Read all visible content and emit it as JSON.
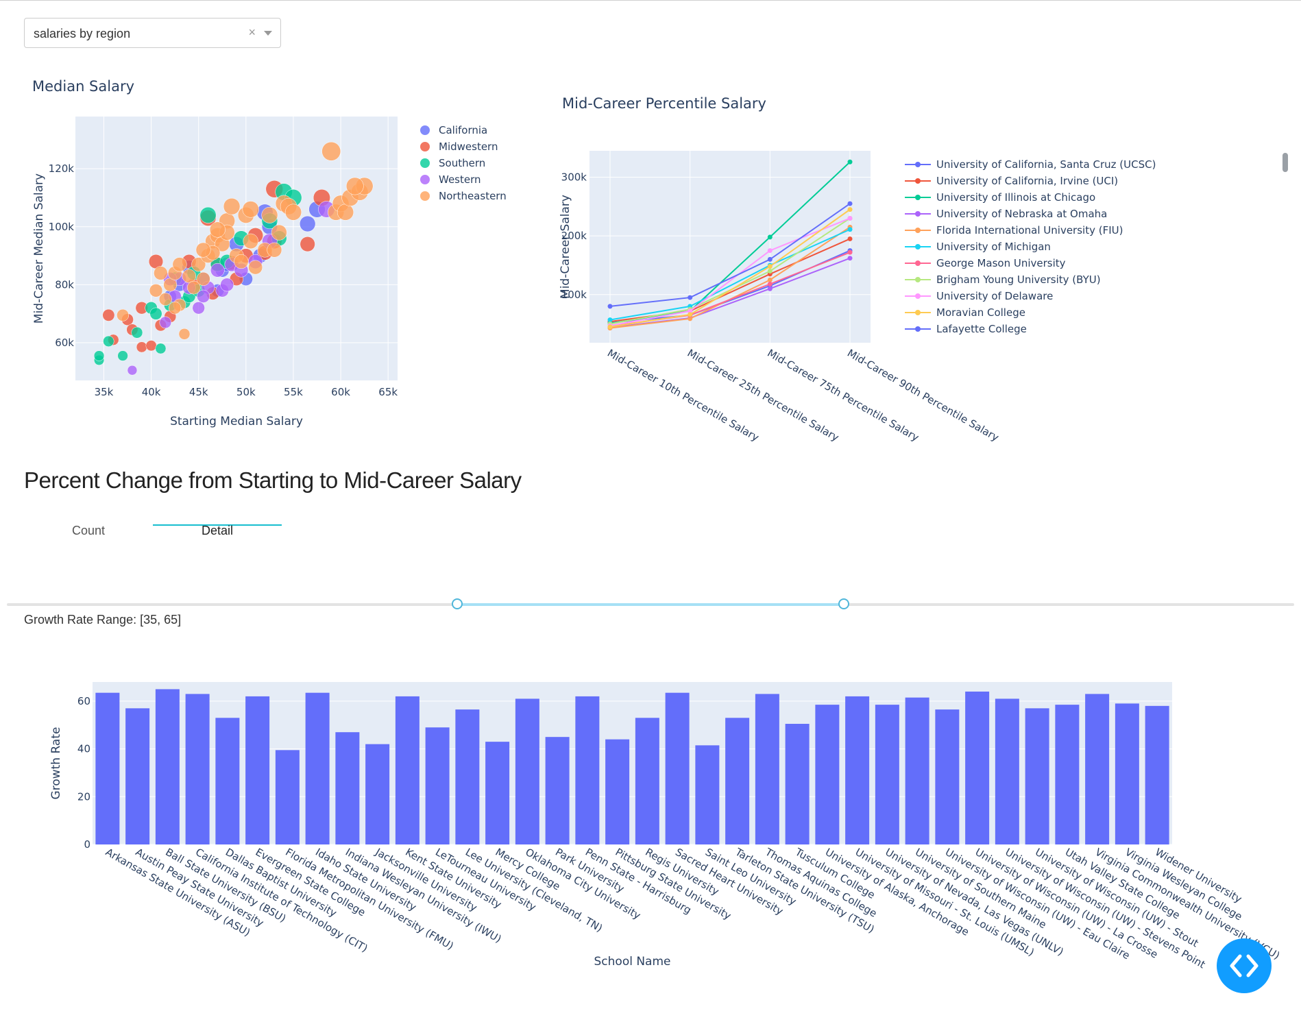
{
  "dropdown": {
    "value": "salaries by region",
    "clear_icon": "close-icon",
    "arrow_icon": "chevron-down-icon"
  },
  "section_title": "Percent Change from Starting to Mid-Career Salary",
  "tabs": [
    {
      "label": "Count",
      "active": false
    },
    {
      "label": "Detail",
      "active": true
    }
  ],
  "slider": {
    "min": 0,
    "max": 100,
    "low": 35,
    "high": 65
  },
  "range_text": "Growth Rate Range: [35, 65]",
  "fab_icon": "code-icon",
  "chart_data": [
    {
      "type": "scatter",
      "title": "Median Salary",
      "xlabel": "Starting Median Salary",
      "ylabel": "Mid-Career Median Salary",
      "xlim": [
        32000,
        66000
      ],
      "ylim": [
        47000,
        138000
      ],
      "xticks": [
        35000,
        40000,
        45000,
        50000,
        55000,
        60000,
        65000
      ],
      "xtick_labels": [
        "35k",
        "40k",
        "45k",
        "50k",
        "55k",
        "60k",
        "65k"
      ],
      "yticks": [
        60000,
        80000,
        100000,
        120000
      ],
      "ytick_labels": [
        "60k",
        "80k",
        "100k",
        "120k"
      ],
      "legend_position": "right",
      "series": [
        {
          "name": "California",
          "color": "#636efa",
          "points": [
            [
              47500,
              85000
            ],
            [
              48000,
              87000
            ],
            [
              50000,
              82000
            ],
            [
              51500,
              90000
            ],
            [
              52000,
              105000
            ],
            [
              52500,
              100000
            ],
            [
              56500,
              101000
            ],
            [
              57500,
              106000
            ],
            [
              47000,
              78000
            ],
            [
              45500,
              82000
            ],
            [
              43000,
              80000
            ],
            [
              42000,
              76000
            ],
            [
              44000,
              86000
            ],
            [
              49000,
              94000
            ]
          ]
        },
        {
          "name": "Midwestern",
          "color": "#ef553b",
          "points": [
            [
              35500,
              69500
            ],
            [
              36000,
              61000
            ],
            [
              37500,
              68000
            ],
            [
              38000,
              64500
            ],
            [
              39000,
              72000
            ],
            [
              39000,
              58500
            ],
            [
              40000,
              59000
            ],
            [
              40500,
              88000
            ],
            [
              41000,
              66000
            ],
            [
              42000,
              69000
            ],
            [
              44000,
              88000
            ],
            [
              46000,
              103000
            ],
            [
              47000,
              87000
            ],
            [
              48500,
              87500
            ],
            [
              49000,
              82000
            ],
            [
              50000,
              90000
            ],
            [
              51000,
              97000
            ],
            [
              52000,
              91000
            ],
            [
              53000,
              95000
            ],
            [
              53000,
              113000
            ],
            [
              56500,
              94000
            ],
            [
              58000,
              110000
            ],
            [
              44500,
              80000
            ],
            [
              46500,
              77000
            ]
          ]
        },
        {
          "name": "Southern",
          "color": "#00cc96",
          "points": [
            [
              34500,
              54000
            ],
            [
              34500,
              55500
            ],
            [
              35500,
              60500
            ],
            [
              37000,
              55500
            ],
            [
              38500,
              63500
            ],
            [
              40000,
              72000
            ],
            [
              40500,
              70000
            ],
            [
              41000,
              58000
            ],
            [
              42000,
              73000
            ],
            [
              42500,
              82000
            ],
            [
              43500,
              74000
            ],
            [
              44000,
              76000
            ],
            [
              45000,
              78000
            ],
            [
              46000,
              104000
            ],
            [
              47000,
              87000
            ],
            [
              48000,
              88000
            ],
            [
              49500,
              96000
            ],
            [
              52500,
              102000
            ],
            [
              53500,
              96000
            ],
            [
              54000,
              112000
            ],
            [
              55000,
              110000
            ],
            [
              44500,
              84000
            ]
          ]
        },
        {
          "name": "Western",
          "color": "#ab63fa",
          "points": [
            [
              38000,
              50500
            ],
            [
              41500,
              67000
            ],
            [
              42500,
              76000
            ],
            [
              43000,
              82000
            ],
            [
              44000,
              79000
            ],
            [
              45000,
              72000
            ],
            [
              46000,
              79000
            ],
            [
              47000,
              85000
            ],
            [
              47500,
              78000
            ],
            [
              48500,
              87000
            ],
            [
              49500,
              85000
            ],
            [
              51000,
              88000
            ],
            [
              52500,
              95000
            ],
            [
              58500,
              106000
            ],
            [
              45500,
              76000
            ],
            [
              48000,
              80000
            ],
            [
              42000,
              82000
            ]
          ]
        },
        {
          "name": "Northeastern",
          "color": "#ffa15a",
          "points": [
            [
              37000,
              69500
            ],
            [
              40500,
              78000
            ],
            [
              41000,
              84000
            ],
            [
              41500,
              75000
            ],
            [
              42000,
              80000
            ],
            [
              42500,
              84000
            ],
            [
              43000,
              87000
            ],
            [
              43500,
              63000
            ],
            [
              44000,
              83000
            ],
            [
              45000,
              87000
            ],
            [
              45500,
              82000
            ],
            [
              46000,
              90000
            ],
            [
              46500,
              95000
            ],
            [
              47000,
              97000
            ],
            [
              47500,
              94000
            ],
            [
              48000,
              102000
            ],
            [
              48500,
              107000
            ],
            [
              49000,
              90000
            ],
            [
              49500,
              88000
            ],
            [
              50000,
              104000
            ],
            [
              50500,
              106000
            ],
            [
              51000,
              86000
            ],
            [
              52000,
              92000
            ],
            [
              53000,
              92000
            ],
            [
              53500,
              98000
            ],
            [
              54000,
              108000
            ],
            [
              54500,
              107000
            ],
            [
              55000,
              105000
            ],
            [
              59000,
              126000
            ],
            [
              59500,
              105000
            ],
            [
              60000,
              108000
            ],
            [
              60500,
              105000
            ],
            [
              61000,
              110000
            ],
            [
              62000,
              112000
            ],
            [
              62500,
              114000
            ],
            [
              61500,
              114000
            ],
            [
              43000,
              73000
            ],
            [
              44500,
              79000
            ],
            [
              46500,
              91000
            ],
            [
              48000,
              98000
            ],
            [
              50500,
              95000
            ],
            [
              52500,
              104000
            ],
            [
              42500,
              72000
            ],
            [
              45500,
              92000
            ],
            [
              47000,
              99000
            ]
          ]
        }
      ]
    },
    {
      "type": "line",
      "title": "Mid-Career Percentile Salary",
      "xlabel": "",
      "ylabel": "Mid-Career Salary",
      "ylim": [
        18000,
        345000
      ],
      "yticks": [
        100000,
        200000,
        300000
      ],
      "ytick_labels": [
        "100k",
        "200k",
        "300k"
      ],
      "categories": [
        "Mid-Career 10th Percentile Salary",
        "Mid-Career 25th Percentile Salary",
        "Mid-Career 75th Percentile Salary",
        "Mid-Career 90th Percentile Salary"
      ],
      "legend_position": "right",
      "series": [
        {
          "name": "University of California, Santa Cruz (UCSC)",
          "color": "#636efa",
          "values": [
            52000,
            65000,
            115000,
            175000
          ]
        },
        {
          "name": "University of California, Irvine (UCI)",
          "color": "#ef553b",
          "values": [
            54000,
            72000,
            135000,
            195000
          ]
        },
        {
          "name": "University of Illinois at Chicago",
          "color": "#00cc96",
          "values": [
            51000,
            72000,
            198000,
            326000
          ]
        },
        {
          "name": "University of Nebraska at Omaha",
          "color": "#ab63fa",
          "values": [
            44000,
            60000,
            110000,
            162000
          ]
        },
        {
          "name": "Florida International University (FIU)",
          "color": "#ffa15a",
          "values": [
            43000,
            59000,
            125000,
            215000
          ]
        },
        {
          "name": "University of Michigan",
          "color": "#19d3f3",
          "values": [
            57000,
            80000,
            150000,
            211000
          ]
        },
        {
          "name": "George Mason University",
          "color": "#ff6692",
          "values": [
            46000,
            65000,
            118000,
            172000
          ]
        },
        {
          "name": "Brigham Young University (BYU)",
          "color": "#b6e880",
          "values": [
            50000,
            75000,
            140000,
            230000
          ]
        },
        {
          "name": "University of Delaware",
          "color": "#ff97ff",
          "values": [
            47000,
            72000,
            175000,
            230000
          ]
        },
        {
          "name": "Moravian College",
          "color": "#fecb52",
          "values": [
            45000,
            66000,
            148000,
            245000
          ]
        },
        {
          "name": "Lafayette College",
          "color": "#636efa",
          "values": [
            80000,
            95000,
            160000,
            255000
          ]
        }
      ]
    },
    {
      "type": "bar",
      "title": "",
      "xlabel": "School Name",
      "ylabel": "Growth Rate",
      "ylim": [
        0,
        68
      ],
      "yticks": [
        0,
        20,
        40,
        60
      ],
      "color": "#636efa",
      "categories": [
        "Arkansas State University (ASU)",
        "Austin Peay State University",
        "Ball State University (BSU)",
        "California Institute of Technology (CIT)",
        "Dallas Baptist University",
        "Evergreen State College",
        "Florida Metropolitan University (FMU)",
        "Idaho State University",
        "Indiana Wesleyan University (IWU)",
        "Jacksonville University",
        "Kent State University",
        "LeTourneau University",
        "Lee University (Cleveland, TN)",
        "Mercy College",
        "Oklahoma City University",
        "Park University",
        "Penn State - Harrisburg",
        "Pittsburg State University",
        "Regis University",
        "Sacred Heart University",
        "Saint Leo University",
        "Tarleton State University (TSU)",
        "Thomas Aquinas College",
        "Tusculum College",
        "University of Alaska, Anchorage",
        "University of Missouri - St. Louis (UMSL)",
        "University of Nevada, Las Vegas (UNLV)",
        "University of Southern Maine",
        "University of Wisconsin (UW) - Eau Claire",
        "University of Wisconsin (UW) - La Crosse",
        "University of Wisconsin (UW) - Stevens Point",
        "University of Wisconsin (UW) - Stout",
        "Utah Valley State College",
        "Virginia Commonwealth University (VCU)",
        "Virginia Wesleyan College",
        "Widener University"
      ],
      "values": [
        63.5,
        57,
        65,
        63,
        53,
        62,
        39.5,
        63.5,
        47,
        42,
        62,
        49,
        56.5,
        43,
        61,
        45,
        62,
        44,
        53,
        63.5,
        41.5,
        53,
        63,
        50.5,
        58.5,
        62,
        58.5,
        61.5,
        56.5,
        64,
        61,
        57,
        58.5,
        63,
        59,
        58
      ]
    }
  ]
}
